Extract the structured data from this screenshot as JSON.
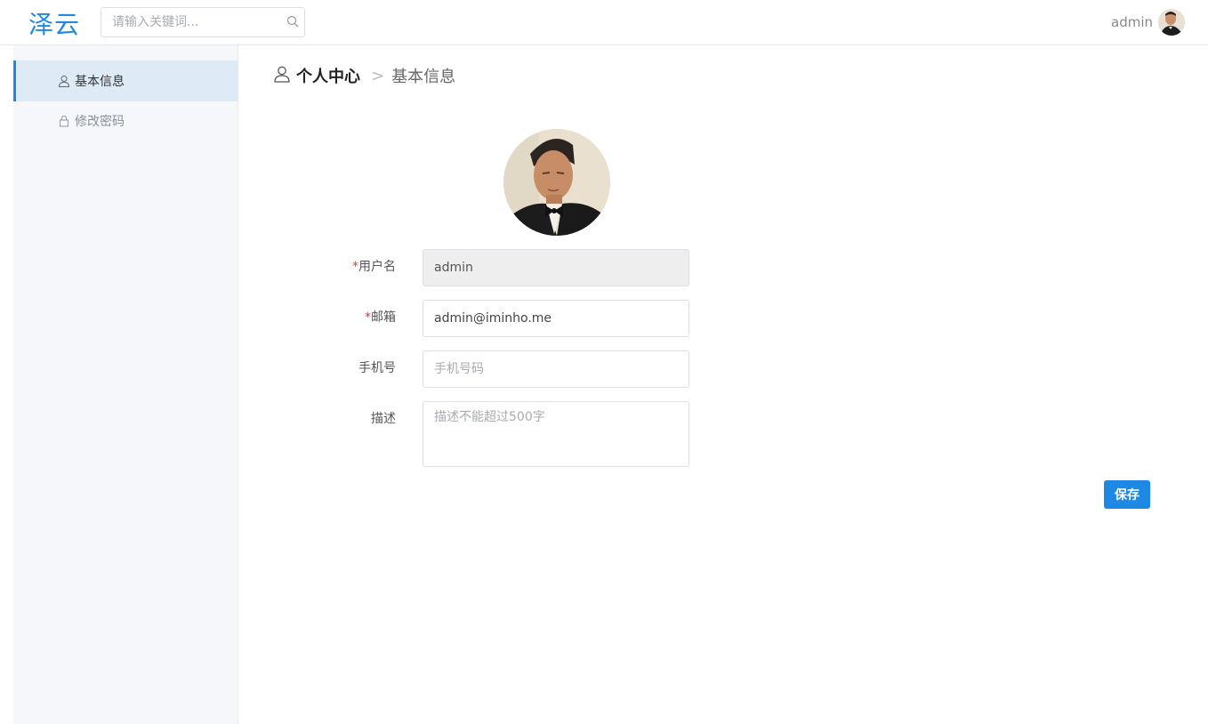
{
  "header": {
    "logo": "泽云",
    "search_placeholder": "请输入关键词...",
    "username": "admin"
  },
  "sidebar": {
    "items": [
      {
        "label": "基本信息",
        "icon": "user-icon",
        "active": true
      },
      {
        "label": "修改密码",
        "icon": "lock-icon",
        "active": false
      }
    ]
  },
  "breadcrumb": {
    "root": "个人中心",
    "separator": ">",
    "current": "基本信息"
  },
  "form": {
    "required_mark": "*",
    "username_label": "用户名",
    "username_value": "admin",
    "email_label": "邮箱",
    "email_value": "admin@iminho.me",
    "phone_label": "手机号",
    "phone_placeholder": "手机号码",
    "desc_label": "描述",
    "desc_placeholder": "描述不能超过500字",
    "save_label": "保存"
  },
  "colors": {
    "accent": "#1e88e5",
    "required": "#e53935"
  }
}
